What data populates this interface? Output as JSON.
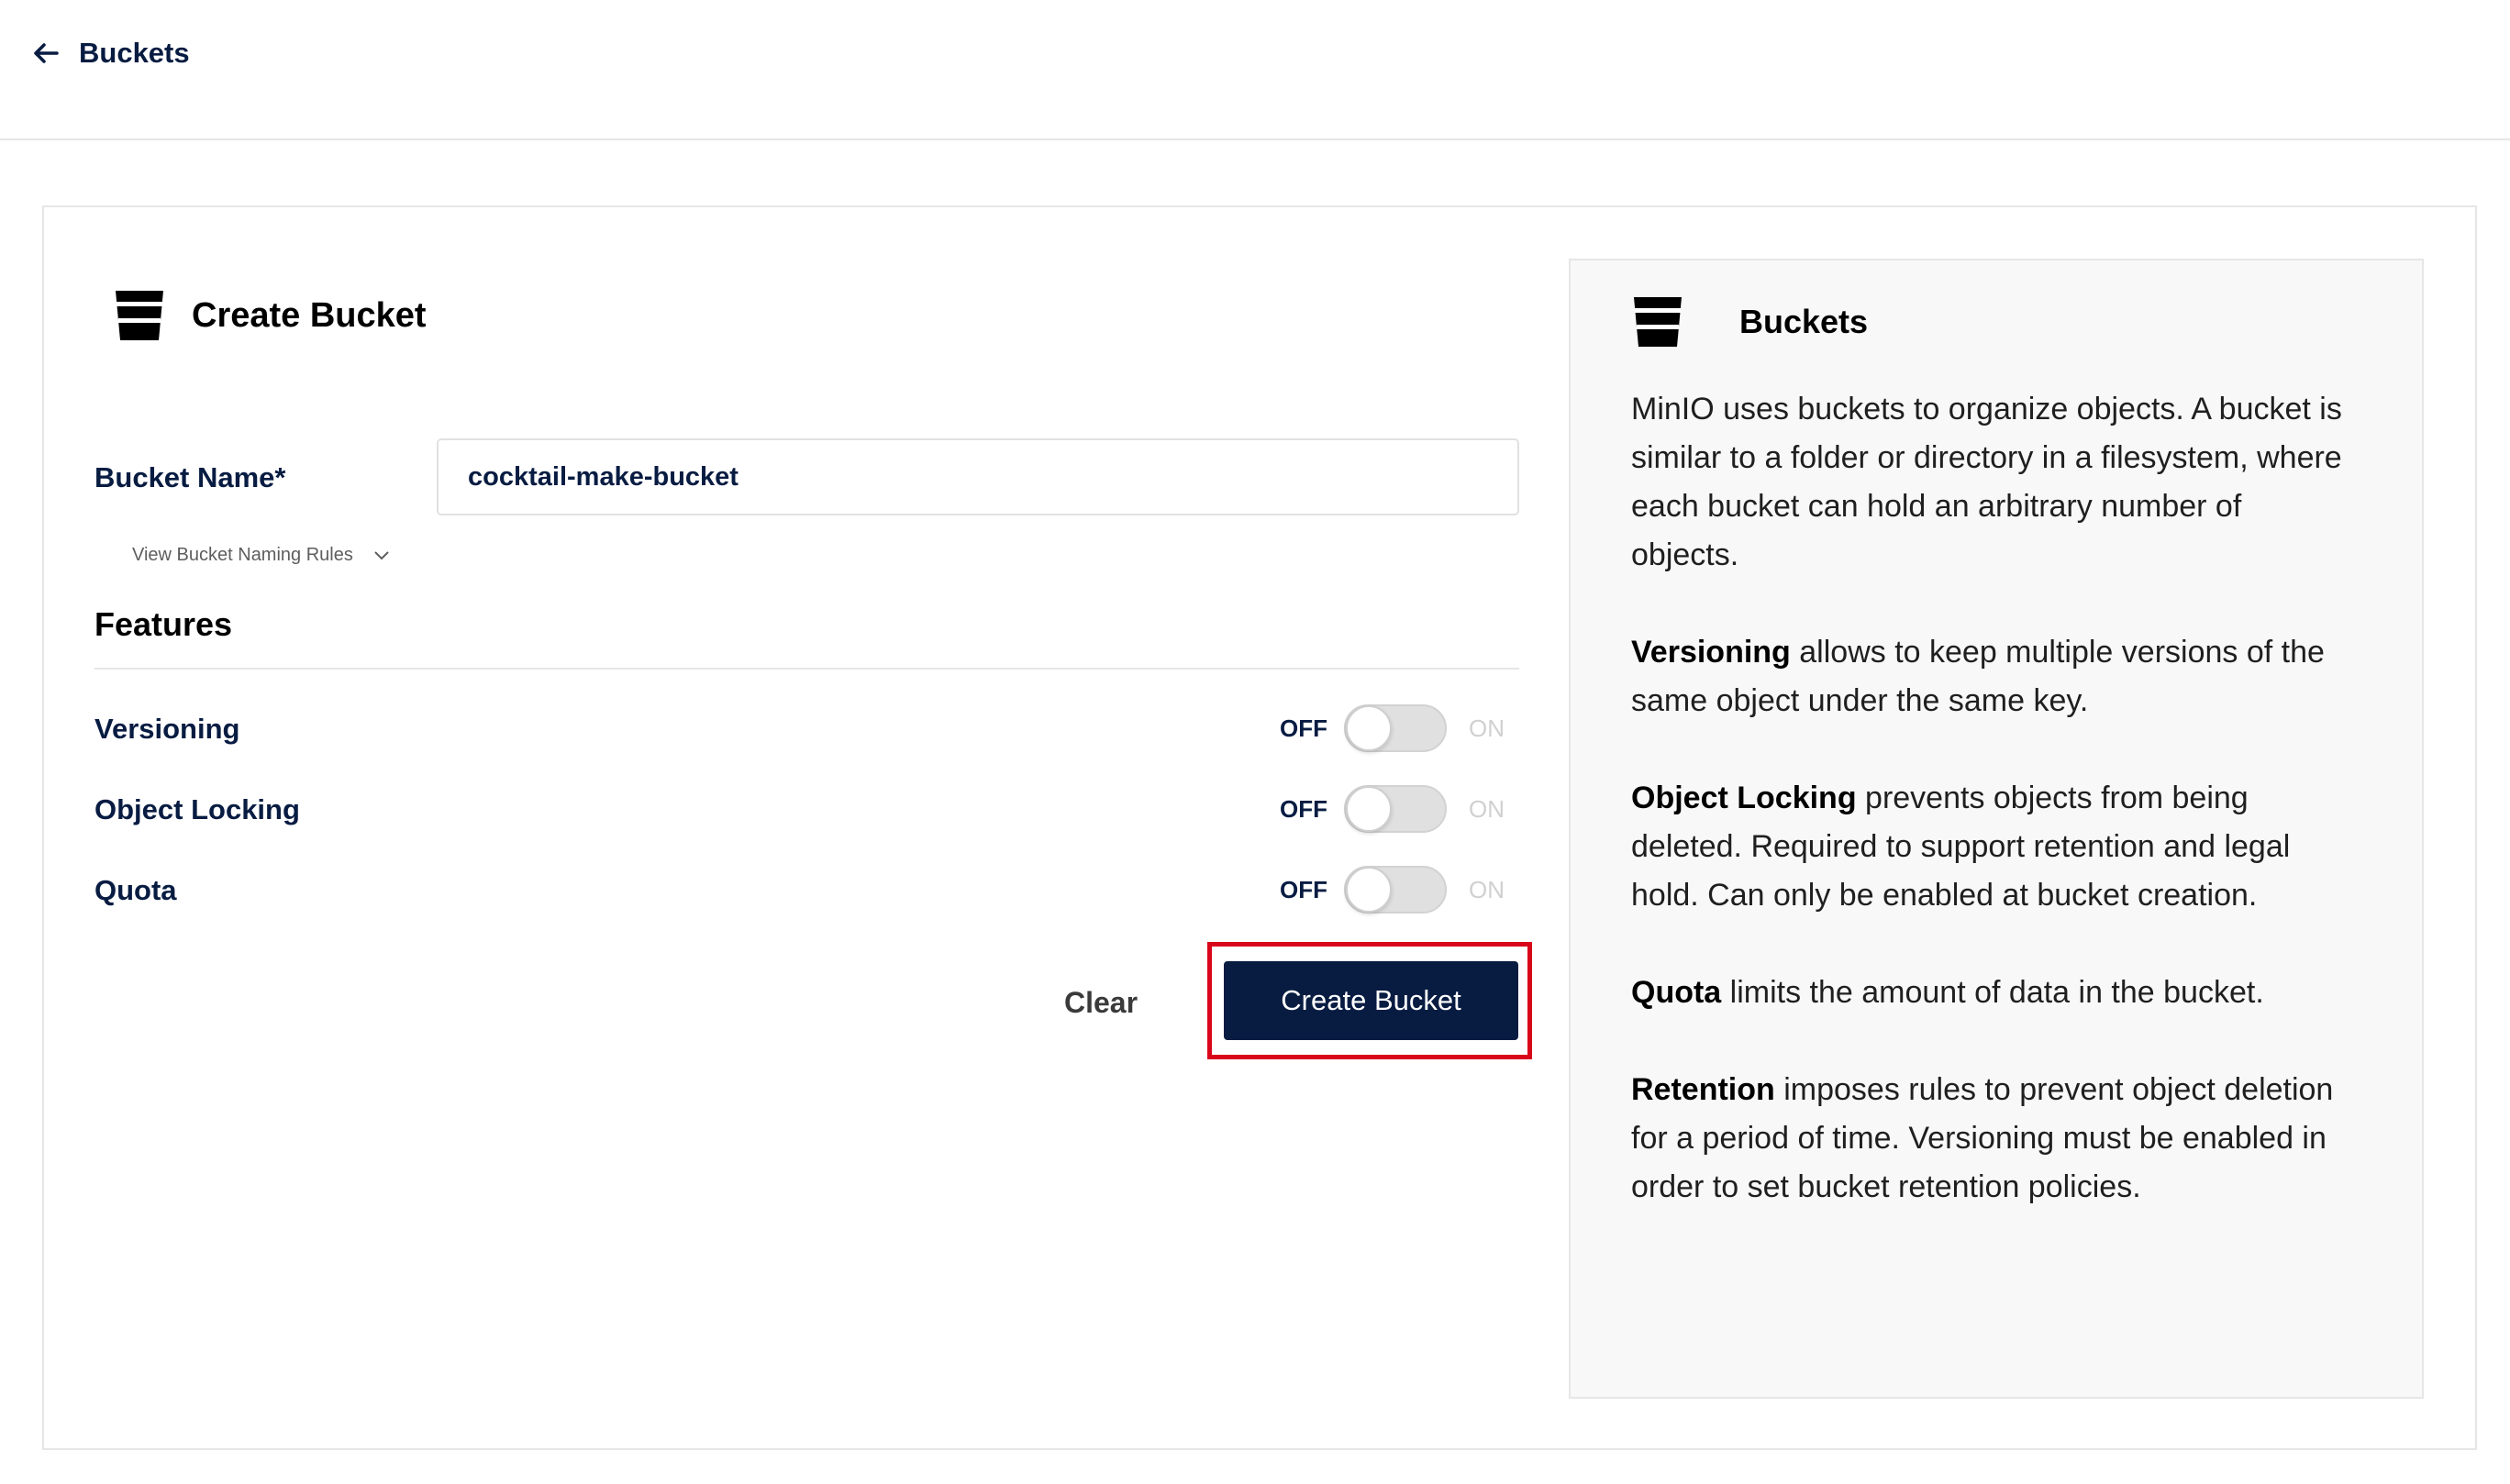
{
  "header": {
    "back_label": "Buckets"
  },
  "form": {
    "title": "Create Bucket",
    "bucket_name_label": "Bucket Name*",
    "bucket_name_value": "cocktail-make-bucket",
    "naming_rules_label": "View Bucket Naming Rules",
    "features_title": "Features",
    "features": [
      {
        "label": "Versioning",
        "off": "OFF",
        "on": "ON",
        "enabled": false
      },
      {
        "label": "Object Locking",
        "off": "OFF",
        "on": "ON",
        "enabled": false
      },
      {
        "label": "Quota",
        "off": "OFF",
        "on": "ON",
        "enabled": false
      }
    ],
    "clear_label": "Clear",
    "create_label": "Create Bucket"
  },
  "help": {
    "title": "Buckets",
    "intro": "MinIO uses buckets to organize objects. A bucket is similar to a folder or directory in a filesystem, where each bucket can hold an arbitrary number of objects.",
    "sections": [
      {
        "term": "Versioning",
        "text": " allows to keep multiple versions of the same object under the same key."
      },
      {
        "term": "Object Locking",
        "text": " prevents objects from being deleted. Required to support retention and legal hold. Can only be enabled at bucket creation."
      },
      {
        "term": "Quota",
        "text": " limits the amount of data in the bucket."
      },
      {
        "term": "Retention",
        "text": " imposes rules to prevent object deletion for a period of time. Versioning must be enabled in order to set bucket retention policies."
      }
    ]
  },
  "colors": {
    "primary": "#081c42",
    "highlight": "#d9061b"
  }
}
